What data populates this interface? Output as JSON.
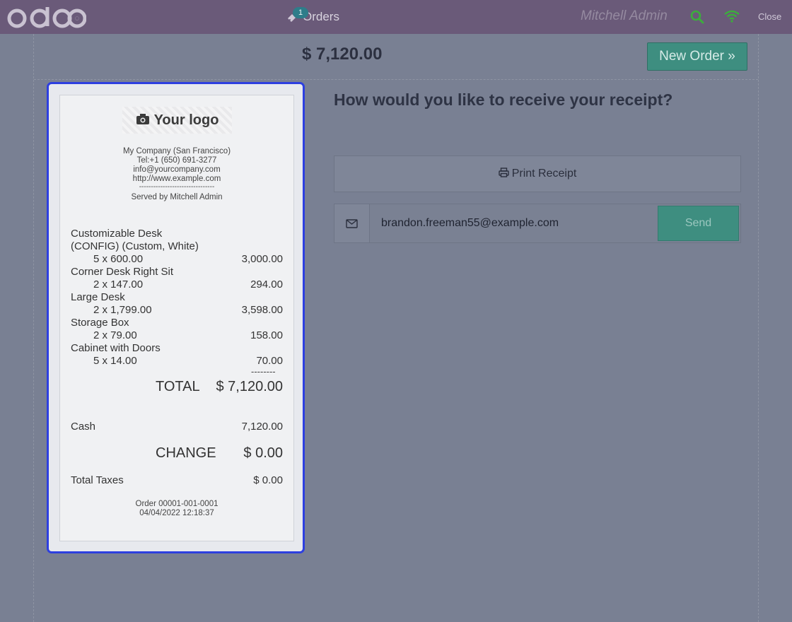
{
  "topbar": {
    "logo_text": "odoo",
    "orders_label": "Orders",
    "orders_count": "1",
    "cashier": "Mitchell Admin",
    "close_label": "Close"
  },
  "order": {
    "total": "$ 7,120.00",
    "new_order_label": "New Order »"
  },
  "receipt": {
    "logo_placeholder": "Your logo",
    "company": {
      "name": "My Company (San Francisco)",
      "phone": "Tel:+1 (650) 691-3277",
      "email": "info@yourcompany.com",
      "website": "http://www.example.com",
      "separator": "--------------------------------",
      "served_by": "Served by Mitchell Admin"
    },
    "lines": [
      {
        "name": "Customizable Desk",
        "name2": "(CONFIG) (Custom, White)",
        "qty_price": "5 x 600.00",
        "amount": "3,000.00"
      },
      {
        "name": "Corner Desk Right Sit",
        "qty_price": "2 x 147.00",
        "amount": "294.00"
      },
      {
        "name": "Large Desk",
        "qty_price": "2 x 1,799.00",
        "amount": "3,598.00"
      },
      {
        "name": "Storage Box",
        "qty_price": "2 x 79.00",
        "amount": "158.00"
      },
      {
        "name": "Cabinet with Doors",
        "qty_price": "5 x 14.00",
        "amount": "70.00"
      }
    ],
    "dashes": "--------",
    "total_label": "TOTAL",
    "total_value": "$ 7,120.00",
    "payment_method": "Cash",
    "payment_amount": "7,120.00",
    "change_label": "CHANGE",
    "change_value": "$ 0.00",
    "taxes_label": "Total Taxes",
    "taxes_value": "$ 0.00",
    "order_ref": "Order 00001-001-0001",
    "order_date": "04/04/2022 12:18:37"
  },
  "receipt_options": {
    "question": "How would you like to receive your receipt?",
    "print_label": "Print Receipt",
    "email_value": "brandon.freeman55@example.com",
    "send_label": "Send"
  },
  "colors": {
    "topbar": "#6a5a79",
    "accent": "#3e8e80",
    "receipt_border": "#2d3fe0"
  }
}
